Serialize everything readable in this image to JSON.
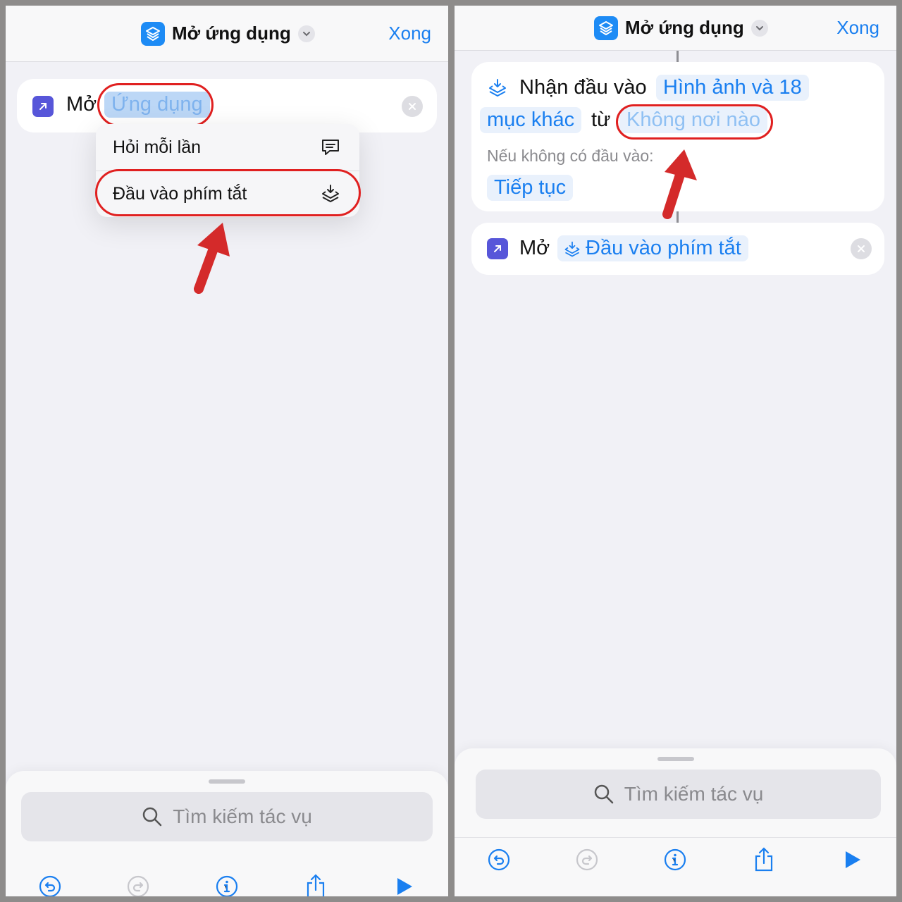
{
  "left": {
    "header": {
      "title": "Mở ứng dụng",
      "done": "Xong"
    },
    "action": {
      "label": "Mở",
      "param": "Ứng dụng"
    },
    "menu": [
      {
        "label": "Hỏi mỗi lần",
        "icon": "chat-bubble-icon"
      },
      {
        "label": "Đầu vào phím tắt",
        "icon": "shortcut-input-icon"
      }
    ],
    "search_placeholder": "Tìm kiếm tác vụ"
  },
  "right": {
    "header": {
      "title": "Mở ứng dụng",
      "done": "Xong"
    },
    "receive": {
      "label": "Nhận đầu vào",
      "types_line1": "Hình ảnh và 18",
      "types_line2": "mục khác",
      "from": "từ",
      "source": "Không nơi nào",
      "if_none": "Nếu không có đầu vào:",
      "continue": "Tiếp tục"
    },
    "action": {
      "label": "Mở",
      "param": "Đầu vào phím tắt"
    },
    "search_placeholder": "Tìm kiếm tác vụ"
  },
  "toolbar": [
    "undo-icon",
    "redo-icon",
    "info-icon",
    "share-icon",
    "play-icon"
  ],
  "colors": {
    "accent": "#1a7ff0",
    "annotation": "#e02020",
    "action_icon": "#5756d9",
    "app_icon": "#1d8bf5"
  }
}
